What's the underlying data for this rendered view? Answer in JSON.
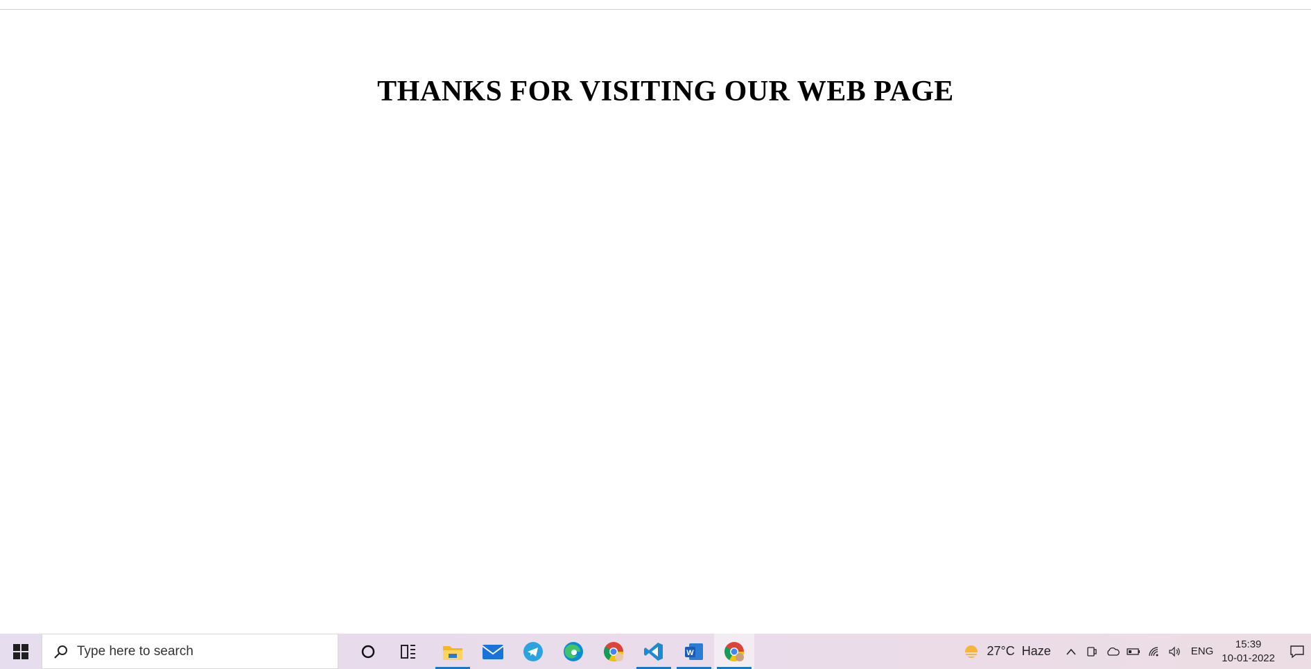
{
  "page": {
    "heading": "THANKS FOR VISITING OUR WEB PAGE"
  },
  "taskbar": {
    "search_placeholder": "Type here to search",
    "apps": [
      {
        "name": "cortana-icon"
      },
      {
        "name": "task-view-icon"
      },
      {
        "name": "file-explorer-icon"
      },
      {
        "name": "mail-icon"
      },
      {
        "name": "telegram-icon"
      },
      {
        "name": "edge-icon"
      },
      {
        "name": "chrome-icon"
      },
      {
        "name": "vscode-icon"
      },
      {
        "name": "word-icon"
      },
      {
        "name": "chrome-profile-icon"
      }
    ],
    "weather": {
      "temperature": "27°C",
      "condition": "Haze"
    },
    "language": "ENG",
    "time": "15:39",
    "date": "10-01-2022"
  },
  "colors": {
    "taskbar_bg": "#e8dcec",
    "accent": "#1a78c2"
  }
}
